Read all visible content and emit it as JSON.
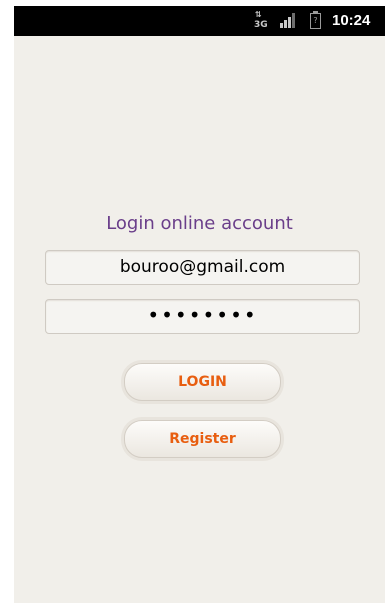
{
  "status_bar": {
    "network_arrows": "⇅",
    "network_type": "3G",
    "battery_glyph": "?",
    "time": "10:24"
  },
  "login_form": {
    "title": "Login online account",
    "email_value": "bouroo@gmail.com",
    "password_value": "••••••••",
    "login_label": "LOGIN",
    "register_label": "Register"
  },
  "colors": {
    "title": "#6a3e8a",
    "button_text": "#e85e10",
    "background": "#f1efea"
  }
}
